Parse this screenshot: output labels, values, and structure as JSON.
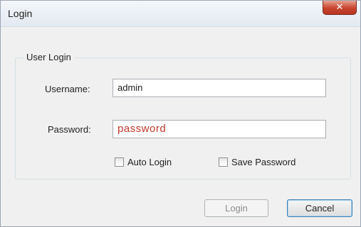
{
  "window": {
    "title": "Login",
    "close_glyph": "✕"
  },
  "group": {
    "legend": "User Login"
  },
  "fields": {
    "username_label": "Username:",
    "username_value": "admin",
    "password_label": "Password:",
    "password_value": "password"
  },
  "options": {
    "auto_login_label": "Auto Login",
    "auto_login_checked": false,
    "save_password_label": "Save Password",
    "save_password_checked": false
  },
  "buttons": {
    "login_label": "Login",
    "cancel_label": "Cancel"
  },
  "icons": {
    "close": "close-icon"
  },
  "colors": {
    "close_button": "#c8442e",
    "password_text": "#c0392b"
  }
}
